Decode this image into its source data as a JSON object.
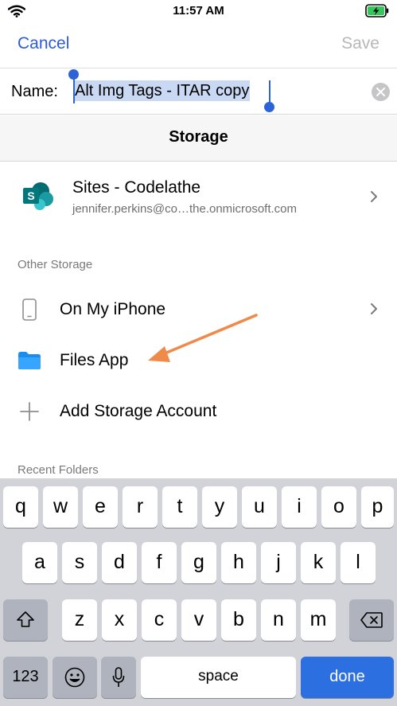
{
  "status_bar": {
    "time": "11:57 AM",
    "wifi_icon": "wifi-icon",
    "battery_icon": "battery-charging-icon"
  },
  "nav": {
    "cancel": "Cancel",
    "save": "Save"
  },
  "name_field": {
    "label": "Name:",
    "value": "Alt Img Tags - ITAR copy",
    "clear_icon": "clear-icon"
  },
  "storage": {
    "title": "Storage"
  },
  "sites": {
    "title": "Sites - Codelathe",
    "subtitle": "jennifer.perkins@co…the.onmicrosoft.com",
    "icon": "sharepoint-icon"
  },
  "other_storage": {
    "label": "Other Storage",
    "items": [
      {
        "label": "On My iPhone",
        "icon": "phone-icon"
      },
      {
        "label": "Files App",
        "icon": "folder-icon"
      },
      {
        "label": "Add Storage Account",
        "icon": "plus-icon"
      }
    ]
  },
  "recent_folders": {
    "label": "Recent Folders"
  },
  "keyboard": {
    "row1": [
      "q",
      "w",
      "e",
      "r",
      "t",
      "y",
      "u",
      "i",
      "o",
      "p"
    ],
    "row2": [
      "a",
      "s",
      "d",
      "f",
      "g",
      "h",
      "j",
      "k",
      "l"
    ],
    "row3": [
      "z",
      "x",
      "c",
      "v",
      "b",
      "n",
      "m"
    ],
    "numbers": "123",
    "space": "space",
    "done": "done"
  },
  "colors": {
    "accent": "#2c5bd6",
    "annotation_arrow": "#f08a4b"
  }
}
